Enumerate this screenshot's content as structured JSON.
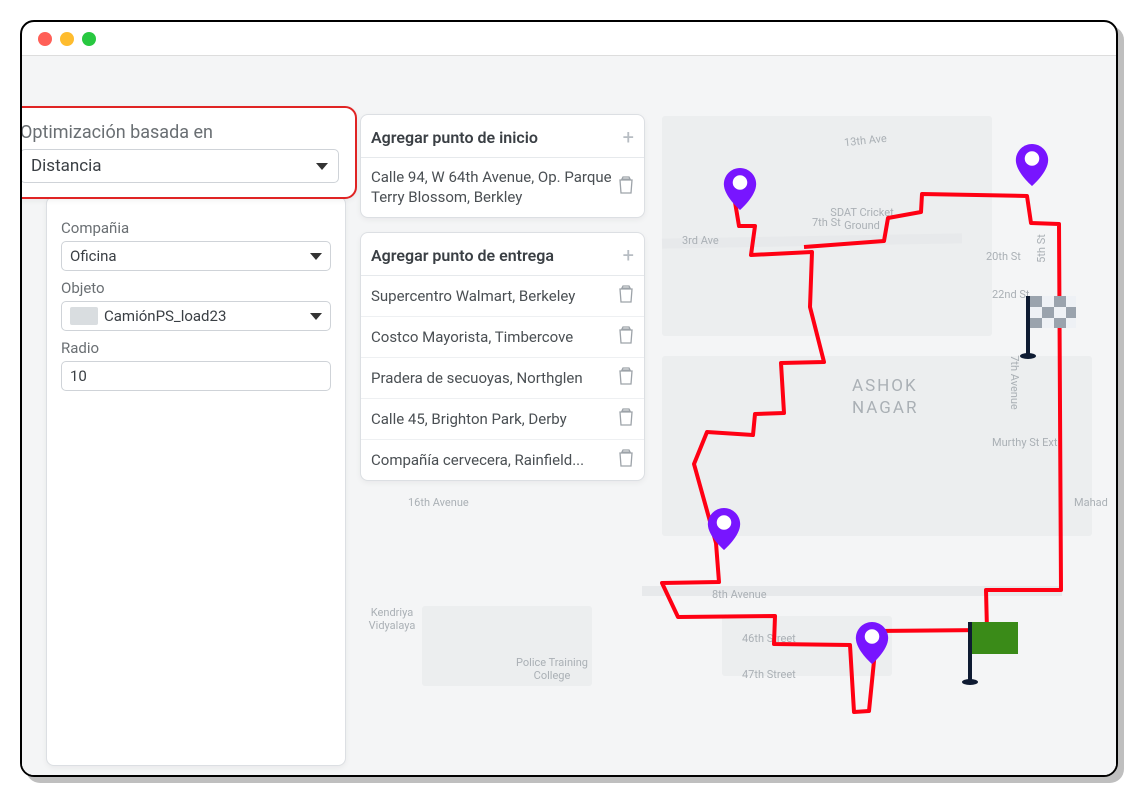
{
  "optimization": {
    "label": "Optimización basada en",
    "value": "Distancia"
  },
  "form": {
    "company_label": "Compañia",
    "company_value": "Oficina",
    "object_label": "Objeto",
    "object_value": "CamiónPS_load23",
    "radio_label": "Radio",
    "radio_value": "10"
  },
  "start_group": {
    "title": "Agregar punto de inicio",
    "items": [
      "Calle 94, W 64th Avenue, Op. Parque Terry Blossom, Berkley"
    ]
  },
  "delivery_group": {
    "title": "Agregar punto de entrega",
    "items": [
      "Supercentro Walmart, Berkeley",
      "Costco Mayorista, Timbercove",
      "Pradera de secuoyas, Northglen",
      "Calle 45, Brighton Park, Derby",
      "Compañía cervecera, Rainfield..."
    ]
  },
  "map": {
    "area_name": [
      "ASHOK",
      "NAGAR"
    ],
    "roads": [
      "3rd Ave",
      "7th St",
      "20th St",
      "22nd St",
      "5th St",
      "7th Avenue",
      "Murthy St Ext",
      "Mahad",
      "8th Avenue",
      "46th Street",
      "47th Street",
      "13th Ave",
      "16th Avenue"
    ],
    "pois": [
      "Kendriya Vidyalaya",
      "Police Training College",
      "SDAT Cricket Ground"
    ]
  },
  "colors": {
    "route": "#ff0013",
    "accent": "#7815ff",
    "highlight": "#e02424",
    "flag_green": "#3a8b18"
  }
}
